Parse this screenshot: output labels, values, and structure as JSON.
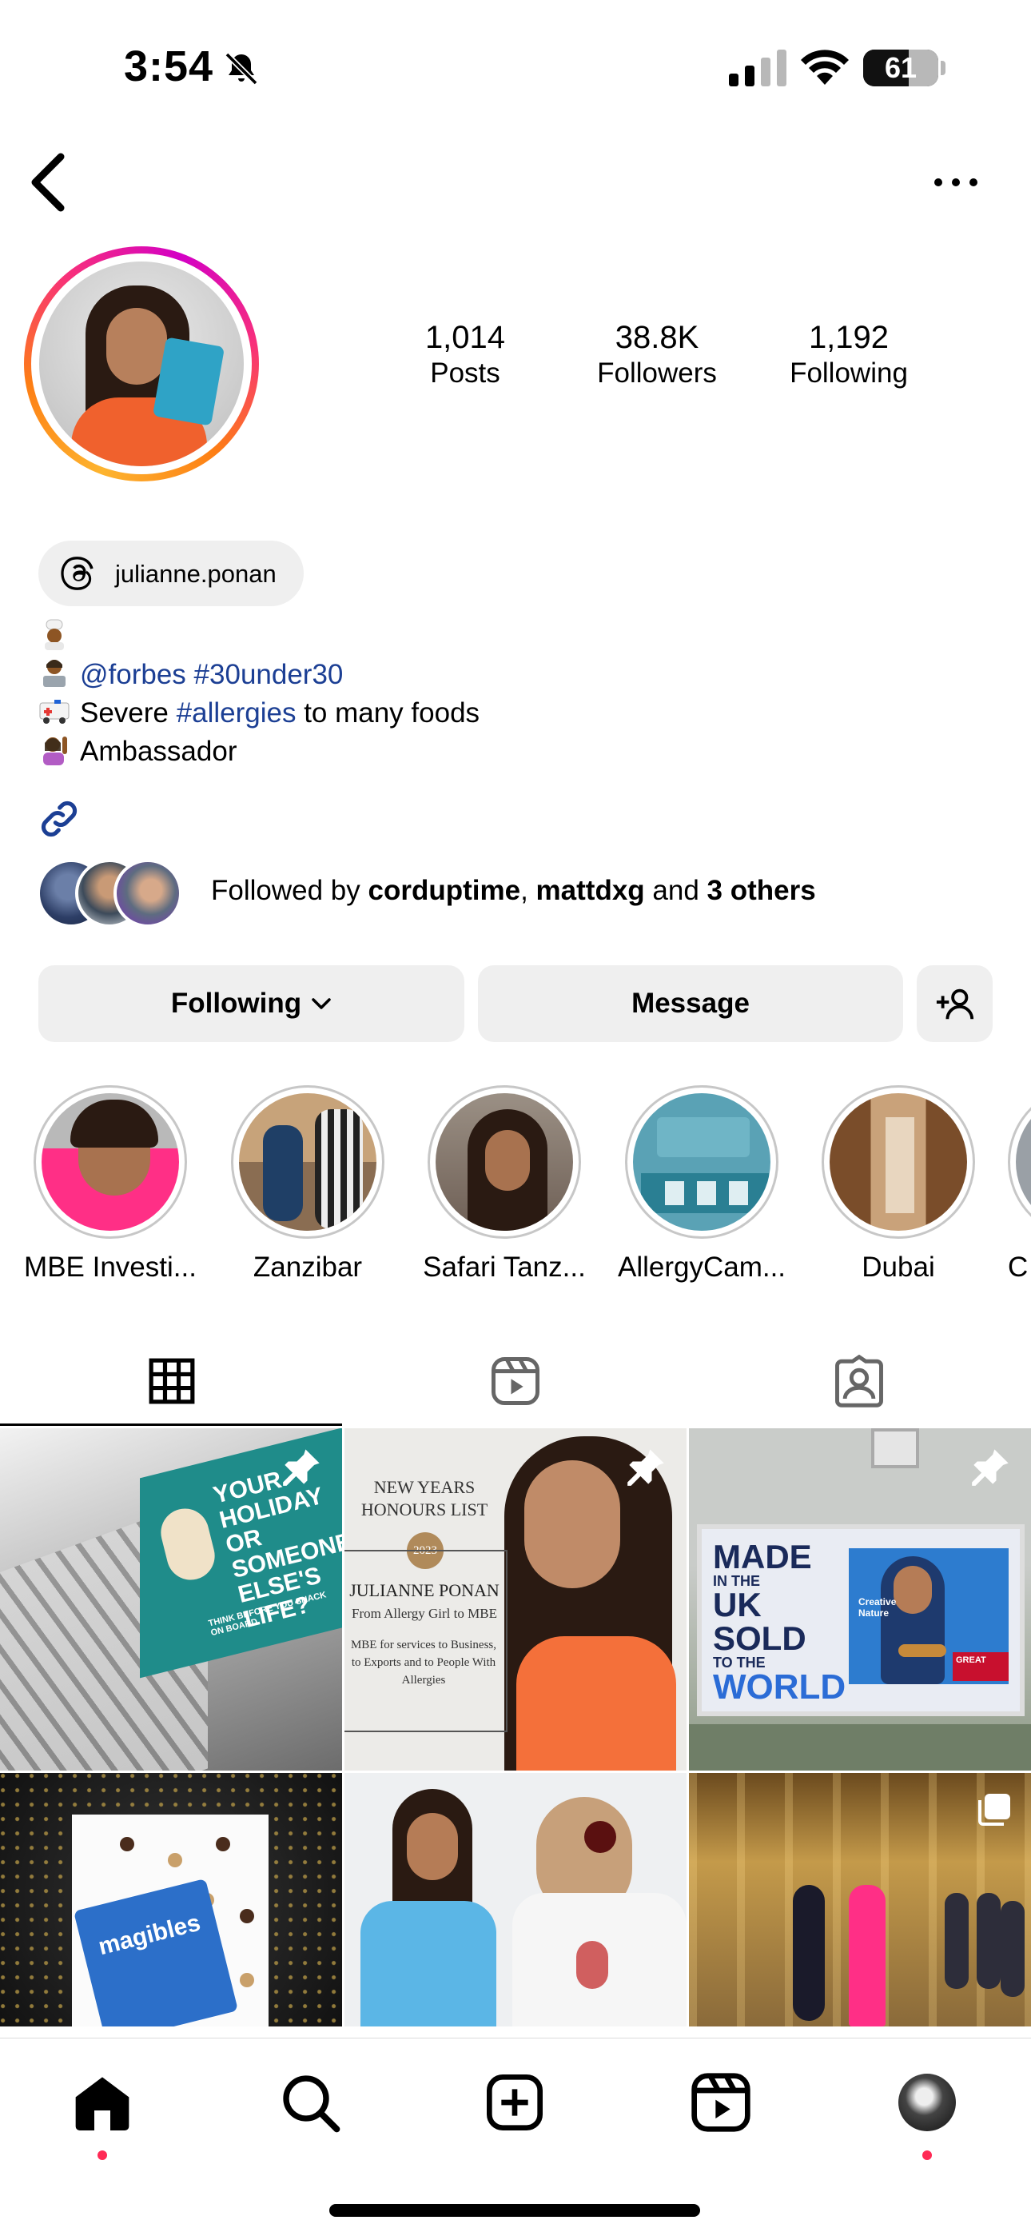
{
  "status_bar": {
    "time": "3:54",
    "battery": "61",
    "battery_level": 0.61
  },
  "profile": {
    "stats": [
      {
        "value": "1,014",
        "label": "Posts"
      },
      {
        "value": "38.8K",
        "label": "Followers"
      },
      {
        "value": "1,192",
        "label": "Following"
      }
    ],
    "threads_handle": "julianne.ponan",
    "bio": {
      "line2_mention": "@forbes",
      "line2_hashtag": "#30under30",
      "line3_prefix": "Severe",
      "line3_hashtag": "#allergies",
      "line3_suffix": "to many foods",
      "line4": "Ambassador"
    },
    "followed_by": {
      "prefix": "Followed by",
      "user1": "corduptime",
      "sep": ",",
      "user2": "mattdxg",
      "and": "and",
      "others": "3 others"
    }
  },
  "actions": {
    "following_label": "Following",
    "message_label": "Message"
  },
  "highlights": [
    {
      "label": "MBE Investi..."
    },
    {
      "label": "Zanzibar"
    },
    {
      "label": "Safari Tanz..."
    },
    {
      "label": "AllergyCam..."
    },
    {
      "label": "Dubai"
    },
    {
      "label": "C"
    }
  ],
  "posts": {
    "post1": {
      "text": "YOUR HOLIDAY OR SOMEONE ELSE'S LIFE?",
      "subtext": "THINK BEFORE YOU SNACK ON BOARD."
    },
    "post2": {
      "title": "NEW YEARS HONOURS LIST",
      "year": "2023",
      "name": "JULIANNE PONAN",
      "subtitle": "From Allergy Girl to MBE",
      "desc": "MBE for services to Business, to Exports and to People With Allergies"
    },
    "post3": {
      "text_made": "MADE",
      "text_in": "IN THE",
      "text_uk": "UK",
      "text_sold": "SOLD",
      "text_to": "TO THE",
      "text_world": "WORLD",
      "brand": "Creative Nature",
      "flag_label": "GREAT"
    },
    "post4": {
      "brand": "magibles"
    }
  },
  "colors": {
    "accent_blue": "#1c3f94",
    "notification_red": "#ff2a55",
    "button_gray": "#efefef"
  }
}
